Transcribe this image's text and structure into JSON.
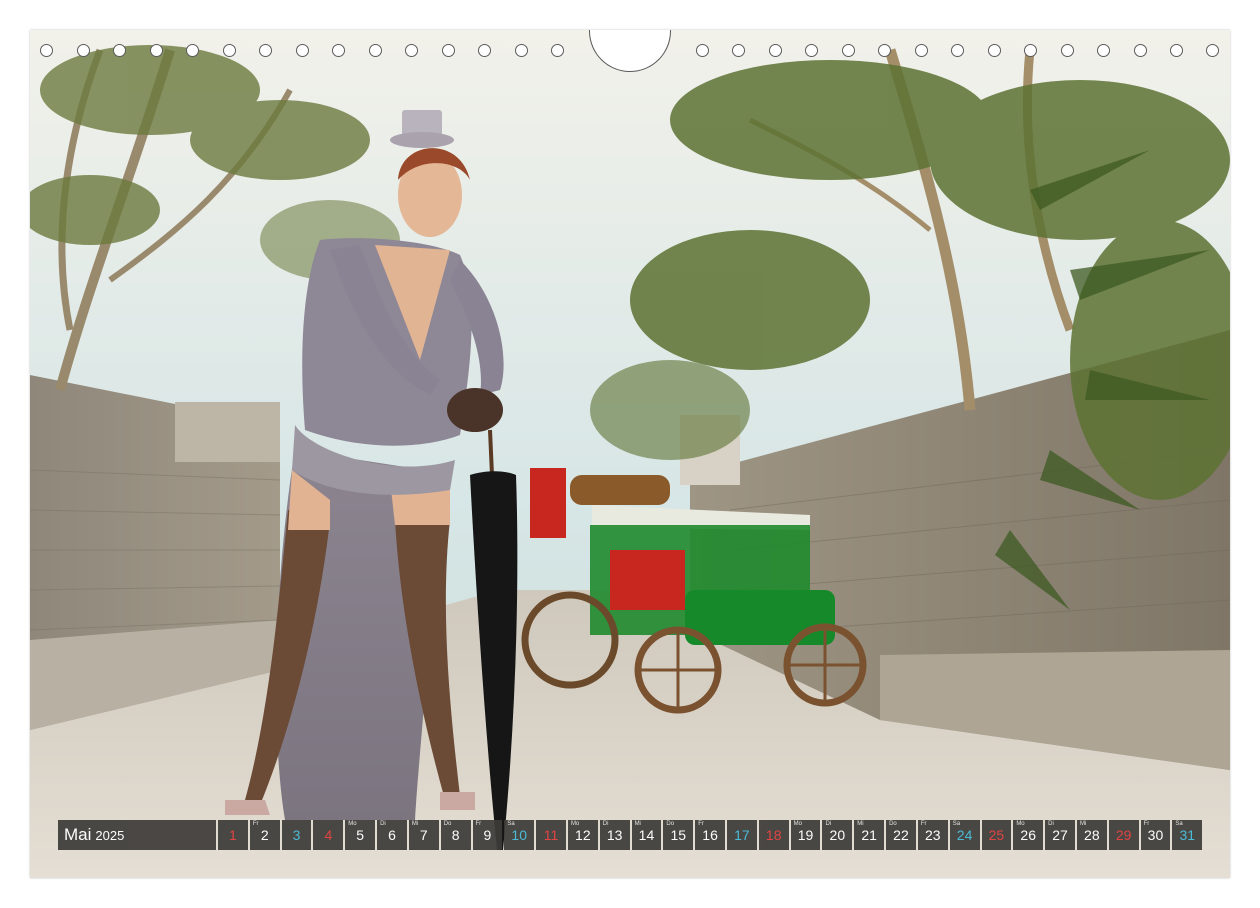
{
  "calendar": {
    "month": "Mai",
    "year": "2025",
    "days": [
      {
        "n": "1",
        "d": "",
        "t": "hol"
      },
      {
        "n": "2",
        "d": "Fr",
        "t": ""
      },
      {
        "n": "3",
        "d": "",
        "t": "sat"
      },
      {
        "n": "4",
        "d": "",
        "t": "sun"
      },
      {
        "n": "5",
        "d": "Mo",
        "t": ""
      },
      {
        "n": "6",
        "d": "Di",
        "t": ""
      },
      {
        "n": "7",
        "d": "Mi",
        "t": ""
      },
      {
        "n": "8",
        "d": "Do",
        "t": ""
      },
      {
        "n": "9",
        "d": "Fr",
        "t": ""
      },
      {
        "n": "10",
        "d": "Sa",
        "t": "sat"
      },
      {
        "n": "11",
        "d": "",
        "t": "sun"
      },
      {
        "n": "12",
        "d": "Mo",
        "t": ""
      },
      {
        "n": "13",
        "d": "Di",
        "t": ""
      },
      {
        "n": "14",
        "d": "Mi",
        "t": ""
      },
      {
        "n": "15",
        "d": "Do",
        "t": ""
      },
      {
        "n": "16",
        "d": "Fr",
        "t": ""
      },
      {
        "n": "17",
        "d": "",
        "t": "sat"
      },
      {
        "n": "18",
        "d": "",
        "t": "sun"
      },
      {
        "n": "19",
        "d": "Mo",
        "t": ""
      },
      {
        "n": "20",
        "d": "Di",
        "t": ""
      },
      {
        "n": "21",
        "d": "Mi",
        "t": ""
      },
      {
        "n": "22",
        "d": "Do",
        "t": ""
      },
      {
        "n": "23",
        "d": "Fr",
        "t": ""
      },
      {
        "n": "24",
        "d": "Sa",
        "t": "sat"
      },
      {
        "n": "25",
        "d": "",
        "t": "sun"
      },
      {
        "n": "26",
        "d": "Mo",
        "t": ""
      },
      {
        "n": "27",
        "d": "Di",
        "t": ""
      },
      {
        "n": "28",
        "d": "Mi",
        "t": ""
      },
      {
        "n": "29",
        "d": "",
        "t": "hol"
      },
      {
        "n": "30",
        "d": "Fr",
        "t": ""
      },
      {
        "n": "31",
        "d": "Sa",
        "t": "sat"
      }
    ]
  },
  "colors": {
    "saturday": "#3fb8d8",
    "sunday": "#e23838",
    "bar": "#3d3b38"
  },
  "photo": {
    "subjects": [
      "woman-in-victorian-outfit",
      "green-steam-car",
      "stone-walls",
      "bamboo-trees"
    ]
  }
}
